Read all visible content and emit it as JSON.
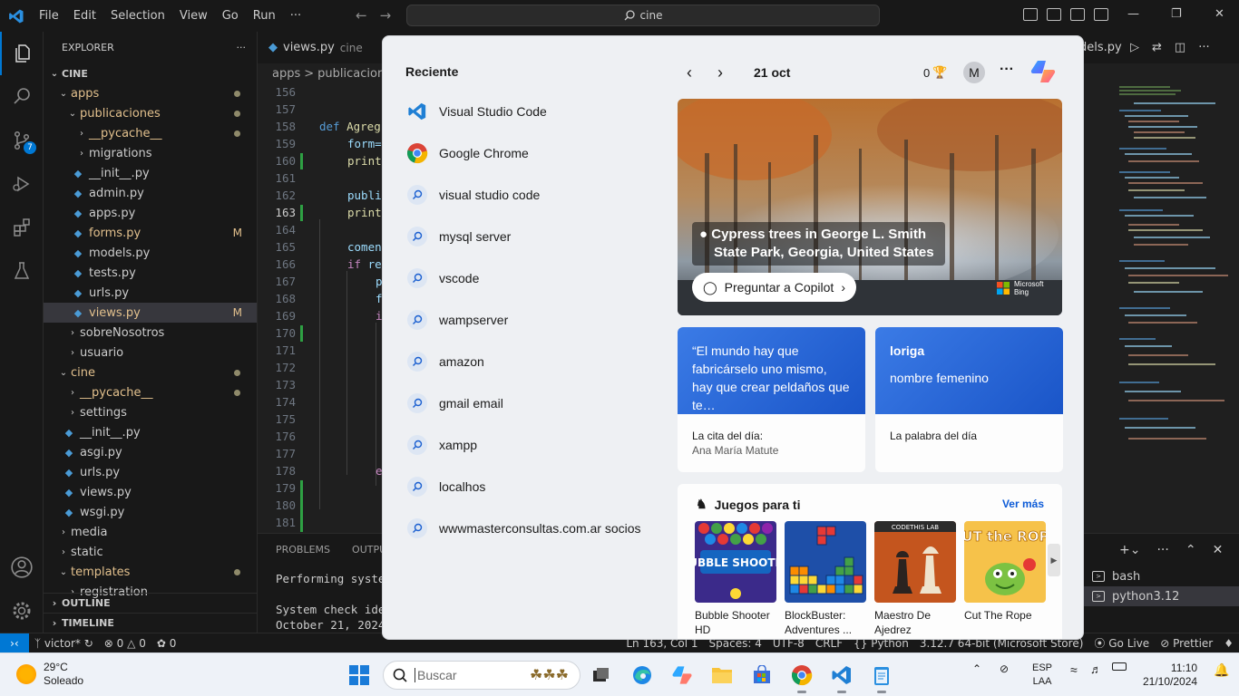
{
  "vscode": {
    "menu": [
      "File",
      "Edit",
      "Selection",
      "View",
      "Go",
      "Run",
      "···"
    ],
    "command_center": "cine",
    "explorer_title": "EXPLORER",
    "more_actions": "···",
    "tree": [
      {
        "label": "CINE",
        "type": "root"
      },
      {
        "label": "apps",
        "type": "folder-open"
      },
      {
        "label": "publicaciones",
        "type": "folder-open"
      },
      {
        "label": "__pycache__",
        "type": "folder"
      },
      {
        "label": "migrations",
        "type": "folder"
      },
      {
        "label": "__init__.py",
        "type": "file"
      },
      {
        "label": "admin.py",
        "type": "file"
      },
      {
        "label": "apps.py",
        "type": "file"
      },
      {
        "label": "forms.py",
        "type": "file",
        "modified": "M"
      },
      {
        "label": "models.py",
        "type": "file"
      },
      {
        "label": "tests.py",
        "type": "file"
      },
      {
        "label": "urls.py",
        "type": "file"
      },
      {
        "label": "views.py",
        "type": "file",
        "modified": "M"
      },
      {
        "label": "sobreNosotros",
        "type": "folder"
      },
      {
        "label": "usuario",
        "type": "folder"
      },
      {
        "label": "cine",
        "type": "folder-open"
      },
      {
        "label": "__pycache__",
        "type": "folder"
      },
      {
        "label": "settings",
        "type": "folder"
      },
      {
        "label": "__init__.py",
        "type": "file"
      },
      {
        "label": "asgi.py",
        "type": "file"
      },
      {
        "label": "urls.py",
        "type": "file"
      },
      {
        "label": "views.py",
        "type": "file"
      },
      {
        "label": "wsgi.py",
        "type": "file"
      },
      {
        "label": "media",
        "type": "folder"
      },
      {
        "label": "static",
        "type": "folder"
      },
      {
        "label": "templates",
        "type": "folder-open"
      },
      {
        "label": "registration",
        "type": "folder"
      }
    ],
    "outline": "OUTLINE",
    "timeline": "TIMELINE",
    "source_control_badge": "7",
    "tab": {
      "file": "views.py",
      "folder": "cine"
    },
    "right_tab": "dels.py",
    "breadcrumb": {
      "part1": "apps",
      "sep": ">",
      "part2": "publicaciones"
    },
    "line_numbers": [
      "156",
      "157",
      "158",
      "159",
      "160",
      "161",
      "162",
      "163",
      "164",
      "165",
      "166",
      "167",
      "168",
      "169",
      "170",
      "171",
      "172",
      "173",
      "174",
      "175",
      "176",
      "177",
      "178",
      "179",
      "180",
      "181"
    ],
    "code": {
      "l158_kw": "def",
      "l158_fn": "Agreg",
      "l159": "form=",
      "l160": "print",
      "l162": "publi",
      "l163": "print",
      "l165": "comen",
      "l166_kw": "if",
      "l166_rest": " re",
      "l167": "p",
      "l168": "f",
      "l169": "i",
      "l176": "e"
    },
    "panel": {
      "tabs": [
        "PROBLEMS",
        "OUTPUT"
      ],
      "line1": "Performing system",
      "line2": "System check iden",
      "line3": "October 21, 2024",
      "terminals": [
        "bash",
        "python3.12"
      ]
    },
    "status": {
      "branch": "victor*",
      "errors": "0",
      "warnings": "0",
      "ports": "0",
      "cursor": "Ln 163, Col 1",
      "spaces": "Spaces: 4",
      "encoding": "UTF-8",
      "eol": "CRLF",
      "language": "Python",
      "interpreter": "3.12.7 64-bit (Microsoft Store)",
      "golive": "Go Live",
      "prettier": "Prettier"
    }
  },
  "flyout": {
    "recent_title": "Reciente",
    "recent": [
      {
        "label": "Visual Studio Code",
        "icon": "vscode-icon"
      },
      {
        "label": "Google Chrome",
        "icon": "chrome-icon"
      },
      {
        "label": "visual studio code",
        "icon": "search-icon"
      },
      {
        "label": "mysql server",
        "icon": "search-icon"
      },
      {
        "label": "vscode",
        "icon": "search-icon"
      },
      {
        "label": "wampserver",
        "icon": "search-icon"
      },
      {
        "label": "amazon",
        "icon": "search-icon"
      },
      {
        "label": "gmail email",
        "icon": "search-icon"
      },
      {
        "label": "xampp",
        "icon": "search-icon"
      },
      {
        "label": "localhos",
        "icon": "search-icon"
      },
      {
        "label": "wwwmasterconsultas.com.ar socios",
        "icon": "search-icon"
      }
    ],
    "date": "21 oct",
    "points": "0",
    "avatar": "M",
    "more": "···",
    "hero": {
      "caption_line1": "Cypress trees in George L. Smith",
      "caption_line2": "State Park, Georgia, United States",
      "button": "Preguntar a Copilot",
      "bing_line1": "Microsoft",
      "bing_line2": "Bing"
    },
    "quote_card": {
      "text": "“El mundo hay que fabricárselo uno mismo, hay que crear peldaños que te…",
      "label": "La cita del día:",
      "author": "Ana María Matute"
    },
    "word_card": {
      "word": "loriga",
      "definition": "nombre femenino",
      "label": "La palabra del día"
    },
    "games": {
      "title": "Juegos para ti",
      "more": "Ver más",
      "items": [
        {
          "name": "Bubble Shooter HD",
          "art": "BUBBLE SHOOTER"
        },
        {
          "name": "BlockBuster: Adventures ...",
          "art": ""
        },
        {
          "name": "Maestro De Ajedrez",
          "art": "CODETHIS LAB"
        },
        {
          "name": "Cut The Rope",
          "art": "CUT the ROPE"
        }
      ]
    }
  },
  "taskbar": {
    "temp": "29°C",
    "weather": "Soleado",
    "search_placeholder": "Buscar",
    "lang1": "ESP",
    "lang2": "LAA",
    "time": "11:10",
    "date": "21/10/2024"
  }
}
